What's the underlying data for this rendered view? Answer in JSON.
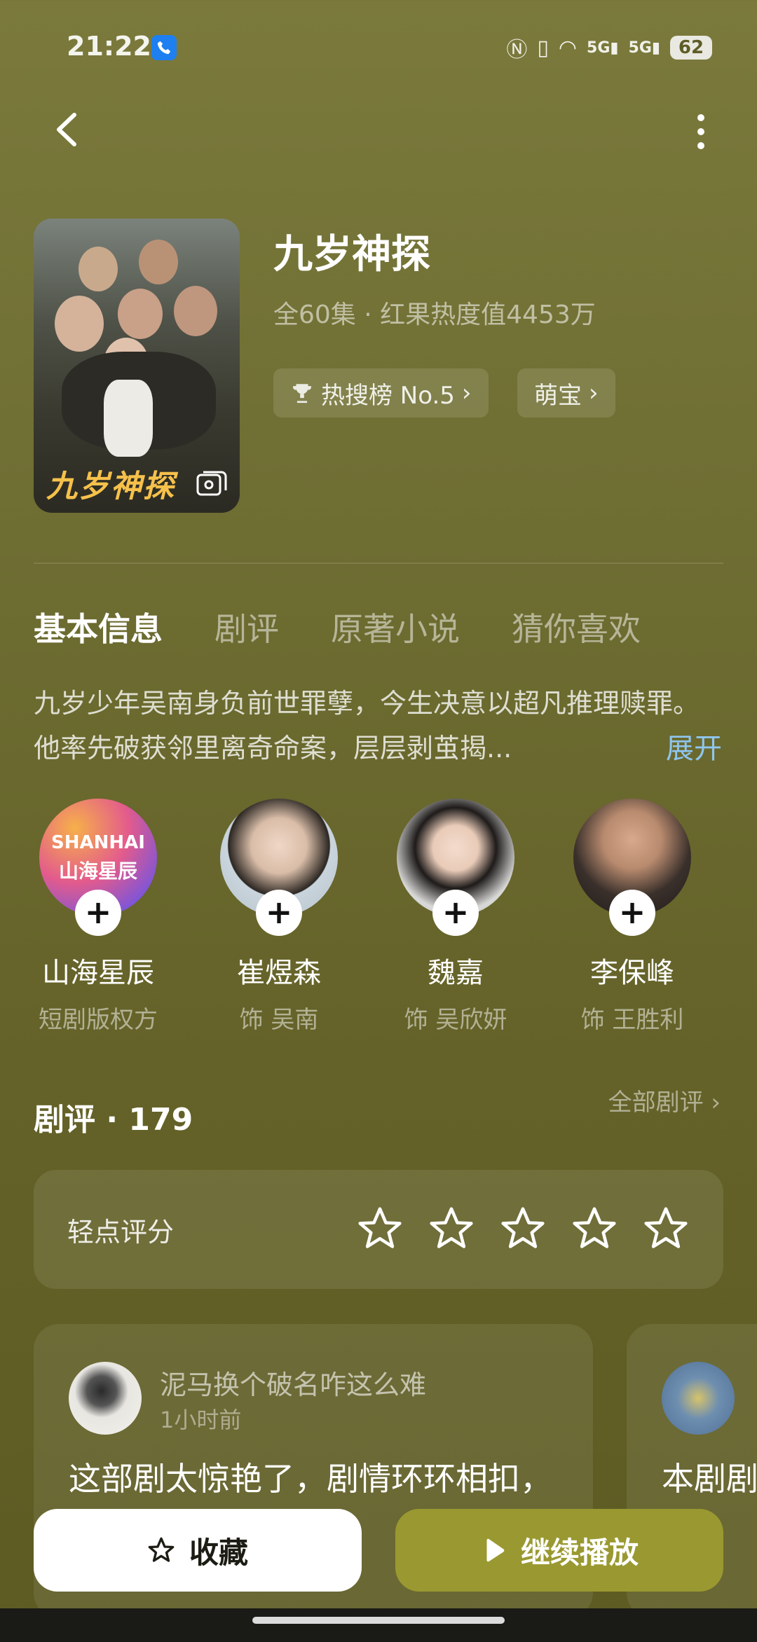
{
  "status_bar": {
    "time": "21:22",
    "signal1": "5G",
    "signal2": "5G",
    "battery": "62"
  },
  "show": {
    "title": "九岁神探",
    "meta": "全60集 · 红果热度值4453万",
    "poster_title": "九岁神探",
    "chips": [
      {
        "label": "热搜榜 No.5",
        "icon": "trophy-icon"
      },
      {
        "label": "萌宝"
      }
    ]
  },
  "tabs": [
    "基本信息",
    "剧评",
    "原著小说",
    "猜你喜欢"
  ],
  "synopsis": {
    "text": "九岁少年吴南身负前世罪孽，今生决意以超凡推理赎罪。他率先破获邻里离奇命案，层层剥茧揭...",
    "expand_label": "展开"
  },
  "cast": [
    {
      "name": "山海星辰",
      "role": "短剧版权方",
      "logo_line1": "SHANHAI",
      "logo_line2": "山海星辰"
    },
    {
      "name": "崔煜森",
      "role": "饰 吴南"
    },
    {
      "name": "魏嘉",
      "role": "饰 吴欣妍"
    },
    {
      "name": "李保峰",
      "role": "饰 王胜利"
    }
  ],
  "reviews": {
    "heading": "剧评 · 179",
    "all_label": "全部剧评",
    "rate_label": "轻点评分",
    "stars": 5,
    "items": [
      {
        "user": "泥马换个破名咋这么难",
        "time": "1小时前",
        "text": "这部剧太惊艳了，剧情环环相扣，剧..."
      },
      {
        "user": "",
        "time": "",
        "text": "本剧剧情..."
      }
    ]
  },
  "actions": {
    "favorite_label": "收藏",
    "play_label": "继续播放"
  },
  "colors": {
    "accent": "#9a9931",
    "link": "#8fc6ef",
    "background": "#6b6a2f"
  }
}
